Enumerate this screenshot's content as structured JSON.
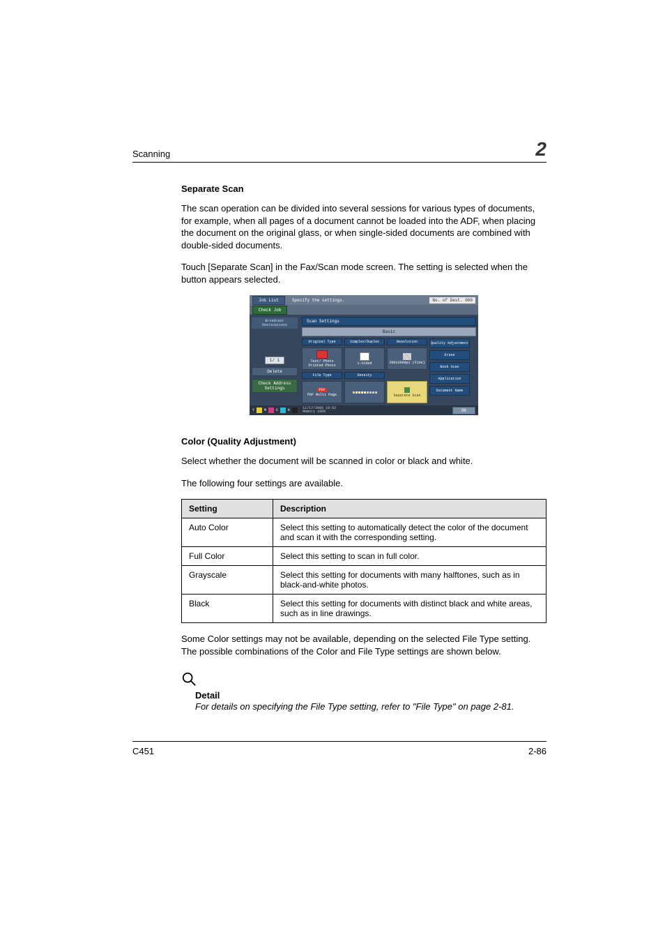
{
  "header": {
    "section": "Scanning",
    "chapter": "2"
  },
  "sep": {
    "heading": "Separate Scan",
    "p1": "The scan operation can be divided into several sessions for various types of documents, for example, when all pages of a document cannot be loaded into the ADF, when placing the document on the original glass, or when single-sided documents are combined with double-sided documents.",
    "p2": "Touch [Separate Scan] in the Fax/Scan mode screen. The setting is selected when the button appears selected."
  },
  "panel": {
    "joblist": "Job List",
    "specify": "Specify the settings.",
    "dest_count": "No. of Dest.   000",
    "checkjob": "Check Job",
    "scansettings": "Scan Settings",
    "basic": "Basic",
    "broadcast": "Broadcast Destinations",
    "pager": "1/  1",
    "delete": "Delete",
    "checkadd": "Check Address Settings",
    "orig_type": "Original Type",
    "orig_val": "Text/ Photo Printed Photo",
    "simplex": "Simplex/Duplex",
    "simplex_val": "1-Sided",
    "resolution": "Resolution",
    "resolution_val": "200x200dpi (Fine)",
    "filetype": "File Type",
    "filetype_val": "PDF Multi Page",
    "density": "Density",
    "sepscan": "Separate Scan",
    "r1": "Quality Adjustment",
    "r2": "Erase",
    "r3": "Book Scan",
    "r4": "Application",
    "r5": "Document Name",
    "datetime": "11/17/2006   19:52",
    "memory": "Memory        100%",
    "ok": "OK"
  },
  "color": {
    "heading": "Color (Quality Adjustment)",
    "p1": "Select whether the document will be scanned in color or black and white.",
    "p2": "The following four settings are available.",
    "th1": "Setting",
    "th2": "Description",
    "rows": [
      {
        "k": "Auto Color",
        "v": "Select this setting to automatically detect the color of the document and scan it with the corresponding setting."
      },
      {
        "k": "Full Color",
        "v": "Select this setting to scan in full color."
      },
      {
        "k": "Grayscale",
        "v": "Select this setting for documents with many halftones, such as in black-and-white photos."
      },
      {
        "k": "Black",
        "v": "Select this setting for documents with distinct black and white areas, such as in line drawings."
      }
    ],
    "after": "Some Color settings may not be available, depending on the selected File Type setting. The possible combinations of the Color and File Type settings are shown below."
  },
  "detail": {
    "head": "Detail",
    "body": "For details on specifying the File Type setting, refer to \"File Type\" on page 2-81."
  },
  "footer": {
    "model": "C451",
    "page": "2-86"
  }
}
